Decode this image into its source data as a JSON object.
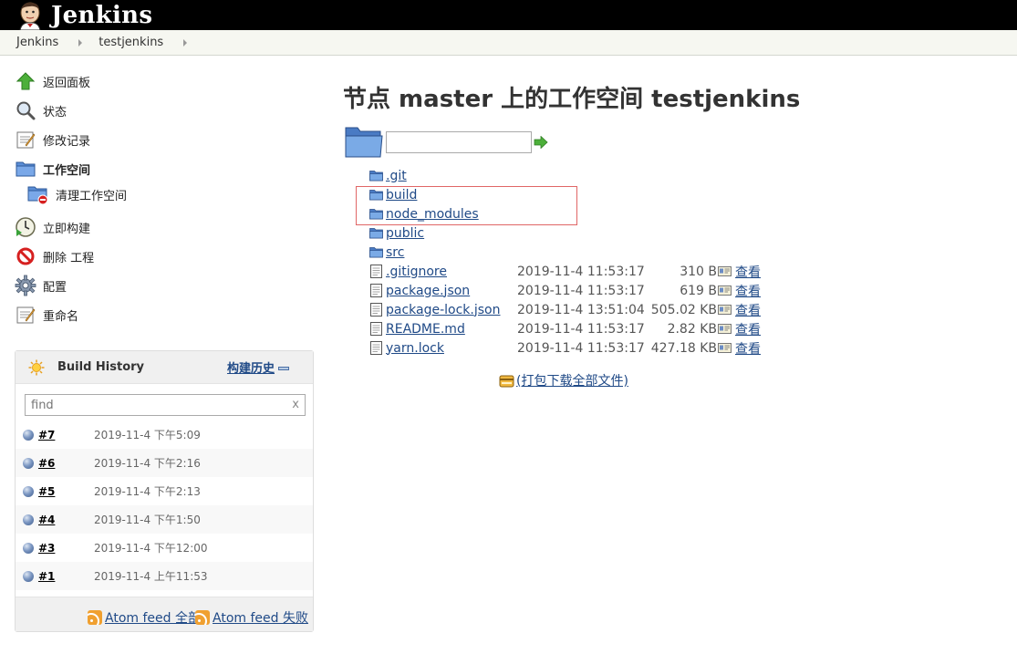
{
  "header": {
    "brand": "Jenkins"
  },
  "breadcrumb": [
    {
      "label": "Jenkins"
    },
    {
      "label": "testjenkins"
    }
  ],
  "tasks": [
    {
      "label": "返回面板",
      "icon": "up-arrow-icon"
    },
    {
      "label": "状态",
      "icon": "magnifier-icon"
    },
    {
      "label": "修改记录",
      "icon": "notepad-icon"
    },
    {
      "label": "工作空间",
      "icon": "folder-icon"
    },
    {
      "label": "清理工作空间",
      "icon": "folder-delete-icon"
    },
    {
      "label": "立即构建",
      "icon": "clock-play-icon"
    },
    {
      "label": "删除 工程",
      "icon": "no-entry-icon"
    },
    {
      "label": "配置",
      "icon": "gear-icon"
    },
    {
      "label": "重命名",
      "icon": "notepad-icon"
    }
  ],
  "build_history": {
    "title": "Build History",
    "trend_label": "构建历史",
    "search_placeholder": "find",
    "search_value": "",
    "clear_label": "x",
    "builds": [
      {
        "num": "#7",
        "time": "2019-11-4 下午5:09"
      },
      {
        "num": "#6",
        "time": "2019-11-4 下午2:16"
      },
      {
        "num": "#5",
        "time": "2019-11-4 下午2:13"
      },
      {
        "num": "#4",
        "time": "2019-11-4 下午1:50"
      },
      {
        "num": "#3",
        "time": "2019-11-4 下午12:00"
      },
      {
        "num": "#1",
        "time": "2019-11-4 上午11:53"
      }
    ],
    "feeds": [
      {
        "label": "Atom feed 全部"
      },
      {
        "label": "Atom feed 失败"
      }
    ]
  },
  "main": {
    "title": "节点 master 上的工作空间 testjenkins",
    "path_value": "",
    "entries": [
      {
        "type": "folder",
        "name": ".git"
      },
      {
        "type": "folder",
        "name": "build"
      },
      {
        "type": "folder",
        "name": "node_modules"
      },
      {
        "type": "folder",
        "name": "public"
      },
      {
        "type": "folder",
        "name": "src"
      },
      {
        "type": "file",
        "name": ".gitignore",
        "date": "2019-11-4 11:53:17",
        "size": "310 B",
        "view": "查看"
      },
      {
        "type": "file",
        "name": "package.json",
        "date": "2019-11-4 11:53:17",
        "size": "619 B",
        "view": "查看"
      },
      {
        "type": "file",
        "name": "package-lock.json",
        "date": "2019-11-4 13:51:04",
        "size": "505.02 KB",
        "view": "查看"
      },
      {
        "type": "file",
        "name": "README.md",
        "date": "2019-11-4 11:53:17",
        "size": "2.82 KB",
        "view": "查看"
      },
      {
        "type": "file",
        "name": "yarn.lock",
        "date": "2019-11-4 11:53:17",
        "size": "427.18 KB",
        "view": "查看"
      }
    ],
    "zip_label": "(打包下载全部文件)"
  },
  "colors": {
    "link": "#204a87",
    "highlight_box": "#e06666",
    "header_bg": "#000000"
  }
}
